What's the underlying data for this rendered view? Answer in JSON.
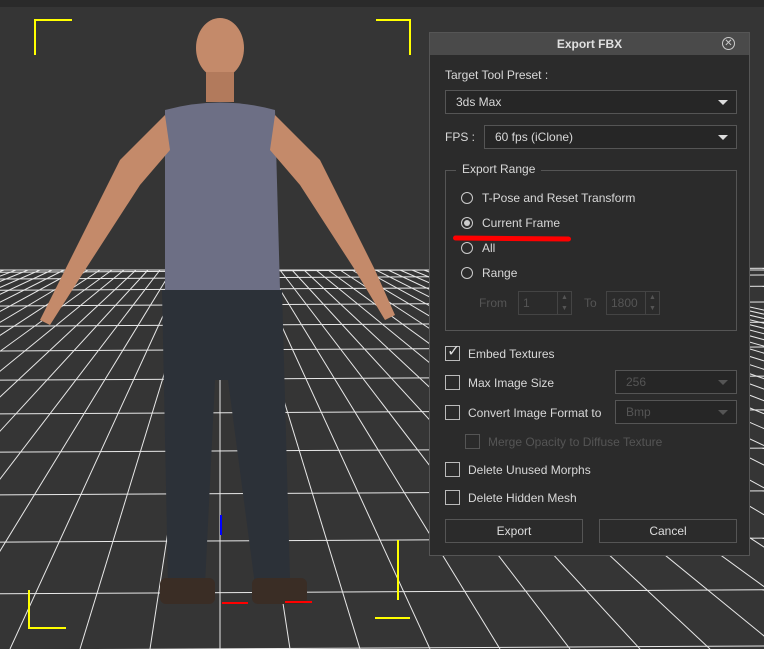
{
  "dialog": {
    "title": "Export FBX",
    "close_icon": "close-circle-icon",
    "target_preset_label": "Target Tool Preset :",
    "target_preset_value": "3ds Max",
    "fps_label": "FPS :",
    "fps_value": "60 fps (iClone)",
    "export_range": {
      "legend": "Export Range",
      "options": [
        {
          "label": "T-Pose and Reset Transform",
          "selected": false
        },
        {
          "label": "Current Frame",
          "selected": true
        },
        {
          "label": "All",
          "selected": false
        },
        {
          "label": "Range",
          "selected": false
        }
      ],
      "from_label": "From",
      "from_value": "1",
      "to_label": "To",
      "to_value": "1800"
    },
    "options": {
      "embed_textures": {
        "label": "Embed Textures",
        "checked": true
      },
      "max_image_size": {
        "label": "Max Image Size",
        "checked": false,
        "value": "256"
      },
      "convert_format": {
        "label": "Convert Image Format to",
        "checked": false,
        "value": "Bmp"
      },
      "merge_opacity": {
        "label": "Merge Opacity to Diffuse Texture",
        "checked": false,
        "disabled": true
      },
      "delete_morphs": {
        "label": "Delete Unused Morphs",
        "checked": false
      },
      "delete_hidden": {
        "label": "Delete Hidden Mesh",
        "checked": false
      }
    },
    "export_button": "Export",
    "cancel_button": "Cancel"
  },
  "colors": {
    "annotation": "#ff0000",
    "frame_brackets": "#ffff00"
  }
}
